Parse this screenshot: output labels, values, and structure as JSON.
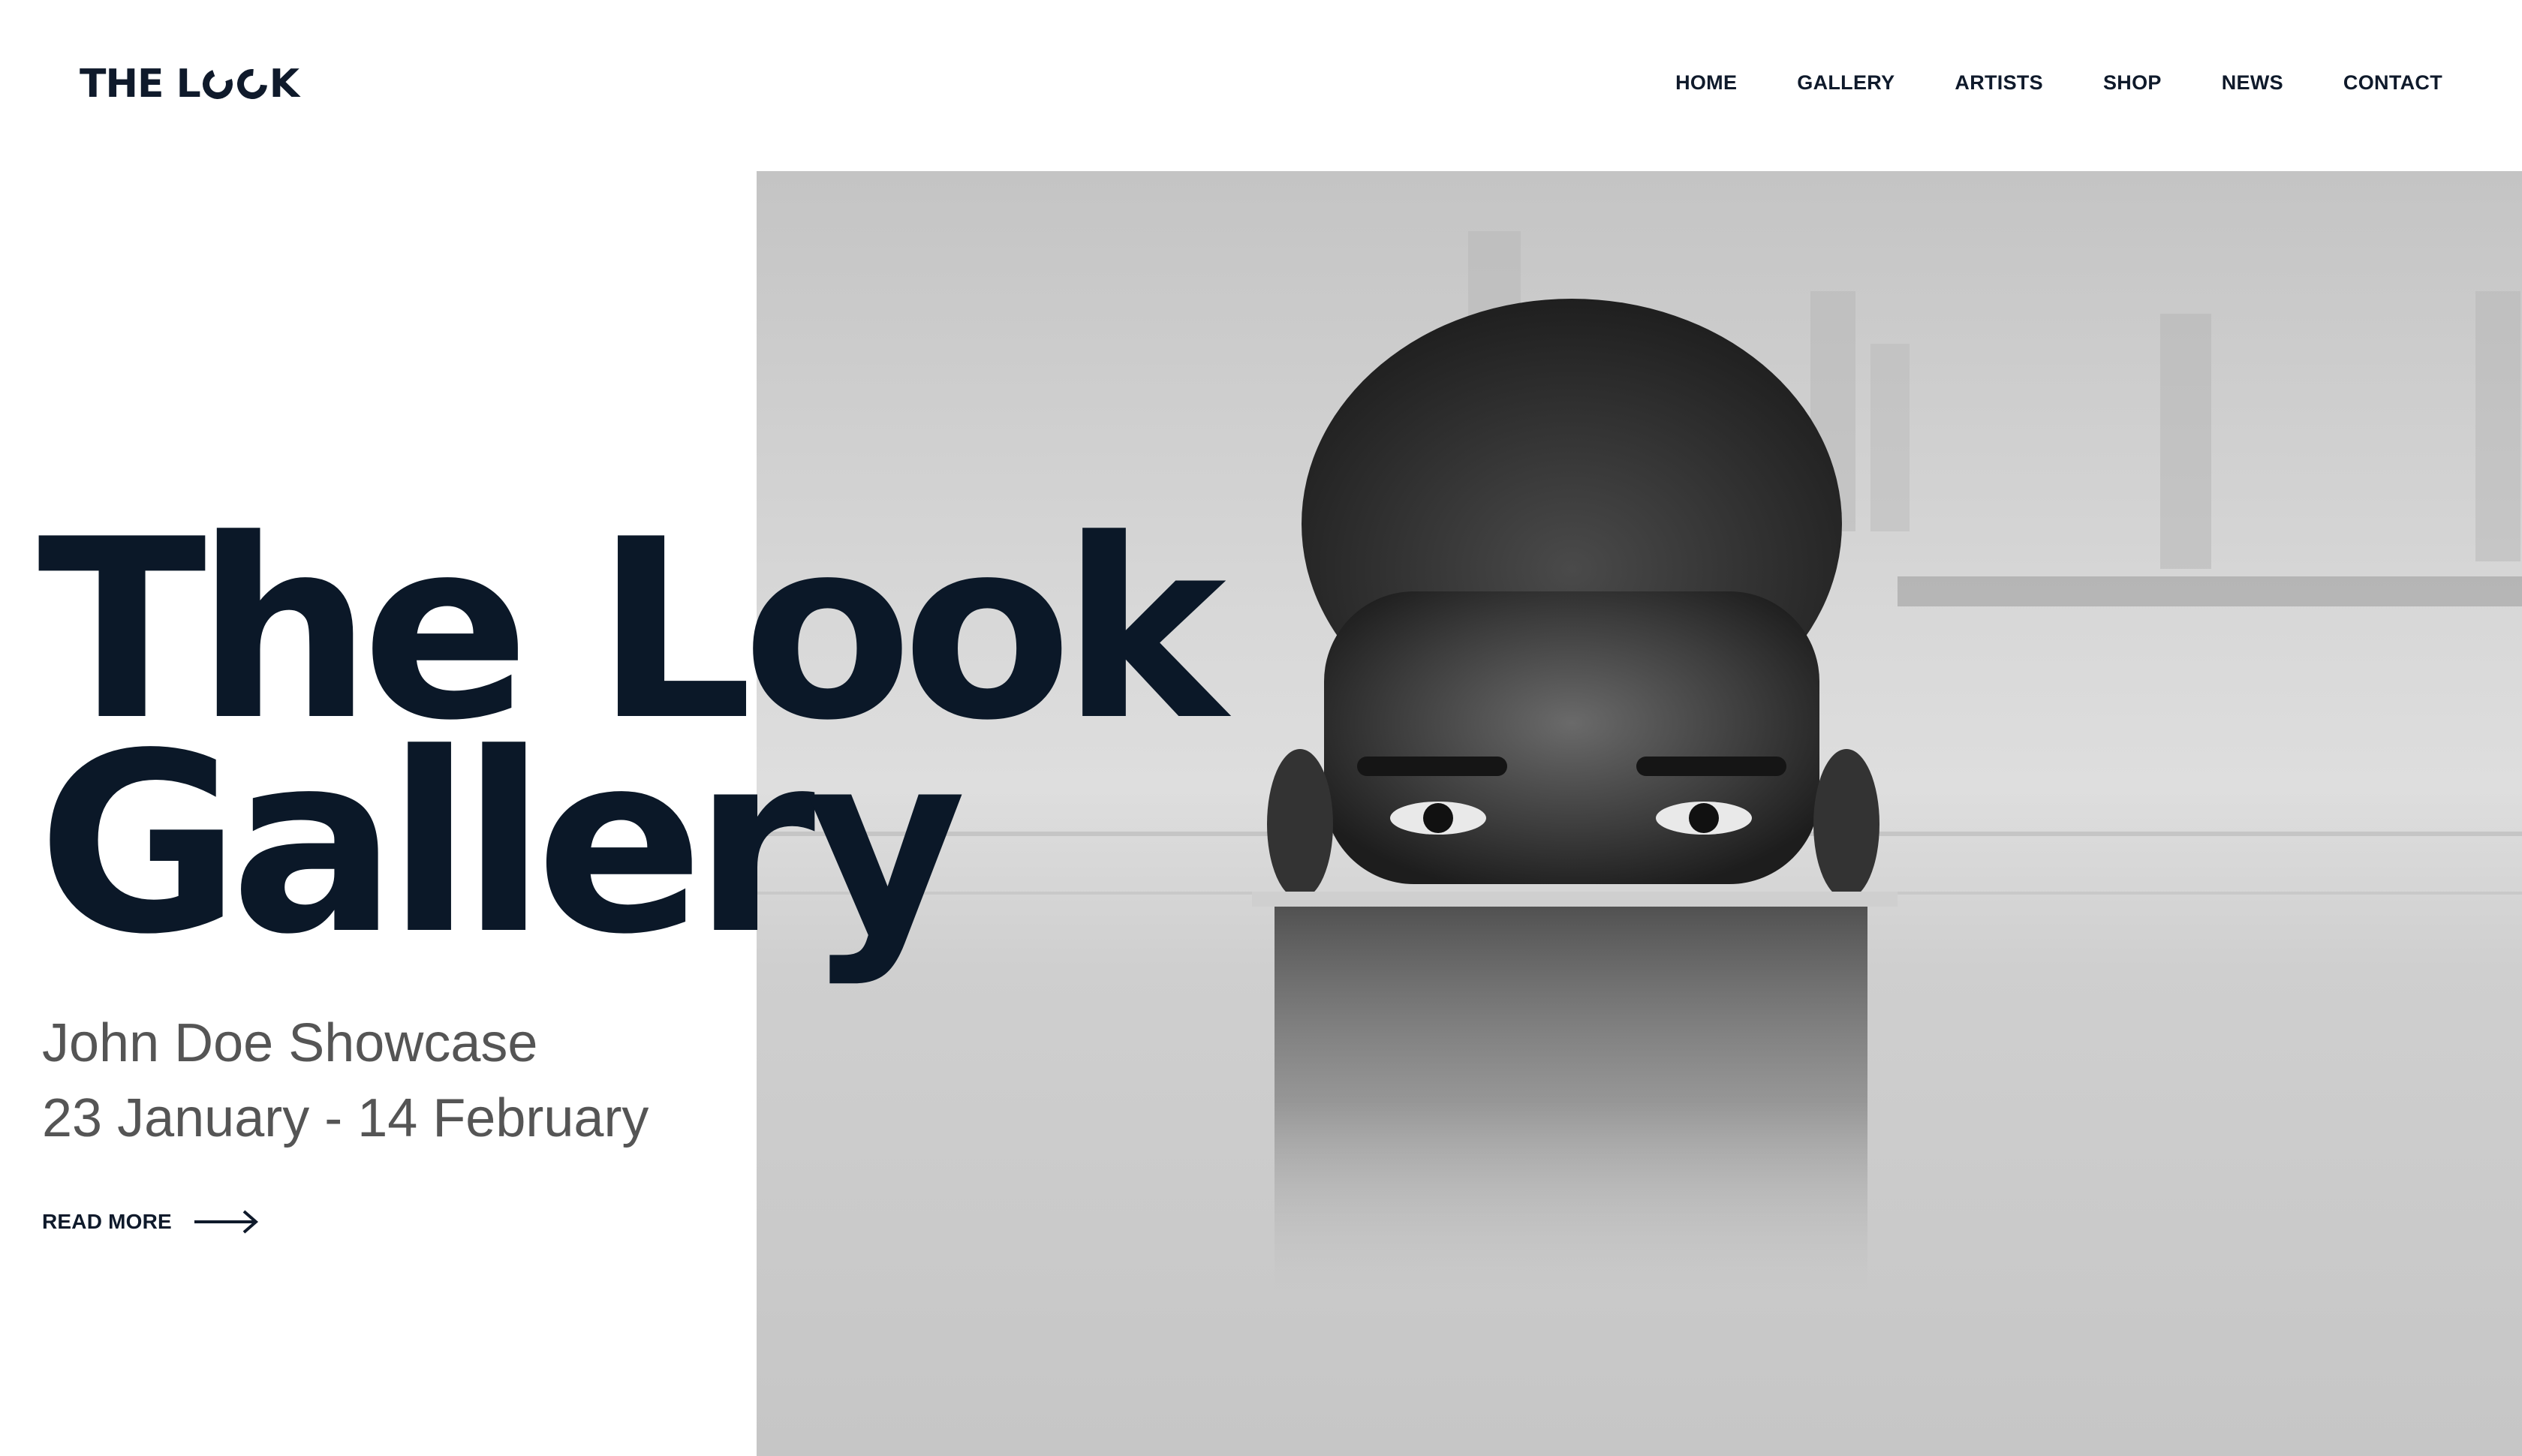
{
  "brand": {
    "logo_text_left": "THE L",
    "logo_text_right": "K",
    "logo_label": "THE LOOK"
  },
  "nav": {
    "items": [
      {
        "label": "HOME"
      },
      {
        "label": "GALLERY"
      },
      {
        "label": "ARTISTS"
      },
      {
        "label": "SHOP"
      },
      {
        "label": "NEWS"
      },
      {
        "label": "CONTACT"
      }
    ]
  },
  "hero": {
    "title_line1": "The Look",
    "title_line2": "Gallery",
    "subtitle_line1": "John Doe Showcase",
    "subtitle_line2": "23 January - 14 February",
    "cta_label": "READ MORE",
    "cta_icon": "arrow-right-icon",
    "image_alt": "Black and white photo of a man submerged in water up to his nose"
  },
  "colors": {
    "text_dark": "#0b1828",
    "text_muted": "#555555",
    "background": "#ffffff"
  }
}
